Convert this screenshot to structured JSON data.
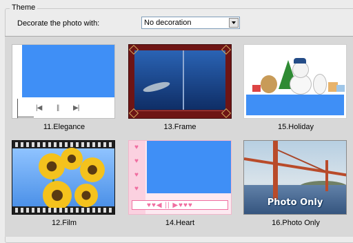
{
  "theme": {
    "legend": "Theme",
    "decorate_label": "Decorate the photo with:",
    "select_value": "No decoration"
  },
  "gallery": {
    "items": [
      {
        "caption": "11.Elegance"
      },
      {
        "caption": "13.Frame"
      },
      {
        "caption": "15.Holiday"
      },
      {
        "caption": "12.Film"
      },
      {
        "caption": "14.Heart"
      },
      {
        "caption": "16.Photo Only",
        "overlay_text": "Photo Only"
      }
    ]
  },
  "colors": {
    "blue_placeholder": "#3f8ff6",
    "frame_red": "#6e1515",
    "heart_pink": "#f06ea0"
  },
  "icons": {
    "prev": "skip-back-icon",
    "pause": "pause-icon",
    "next": "skip-forward-icon",
    "dropdown": "chevron-down-icon"
  }
}
